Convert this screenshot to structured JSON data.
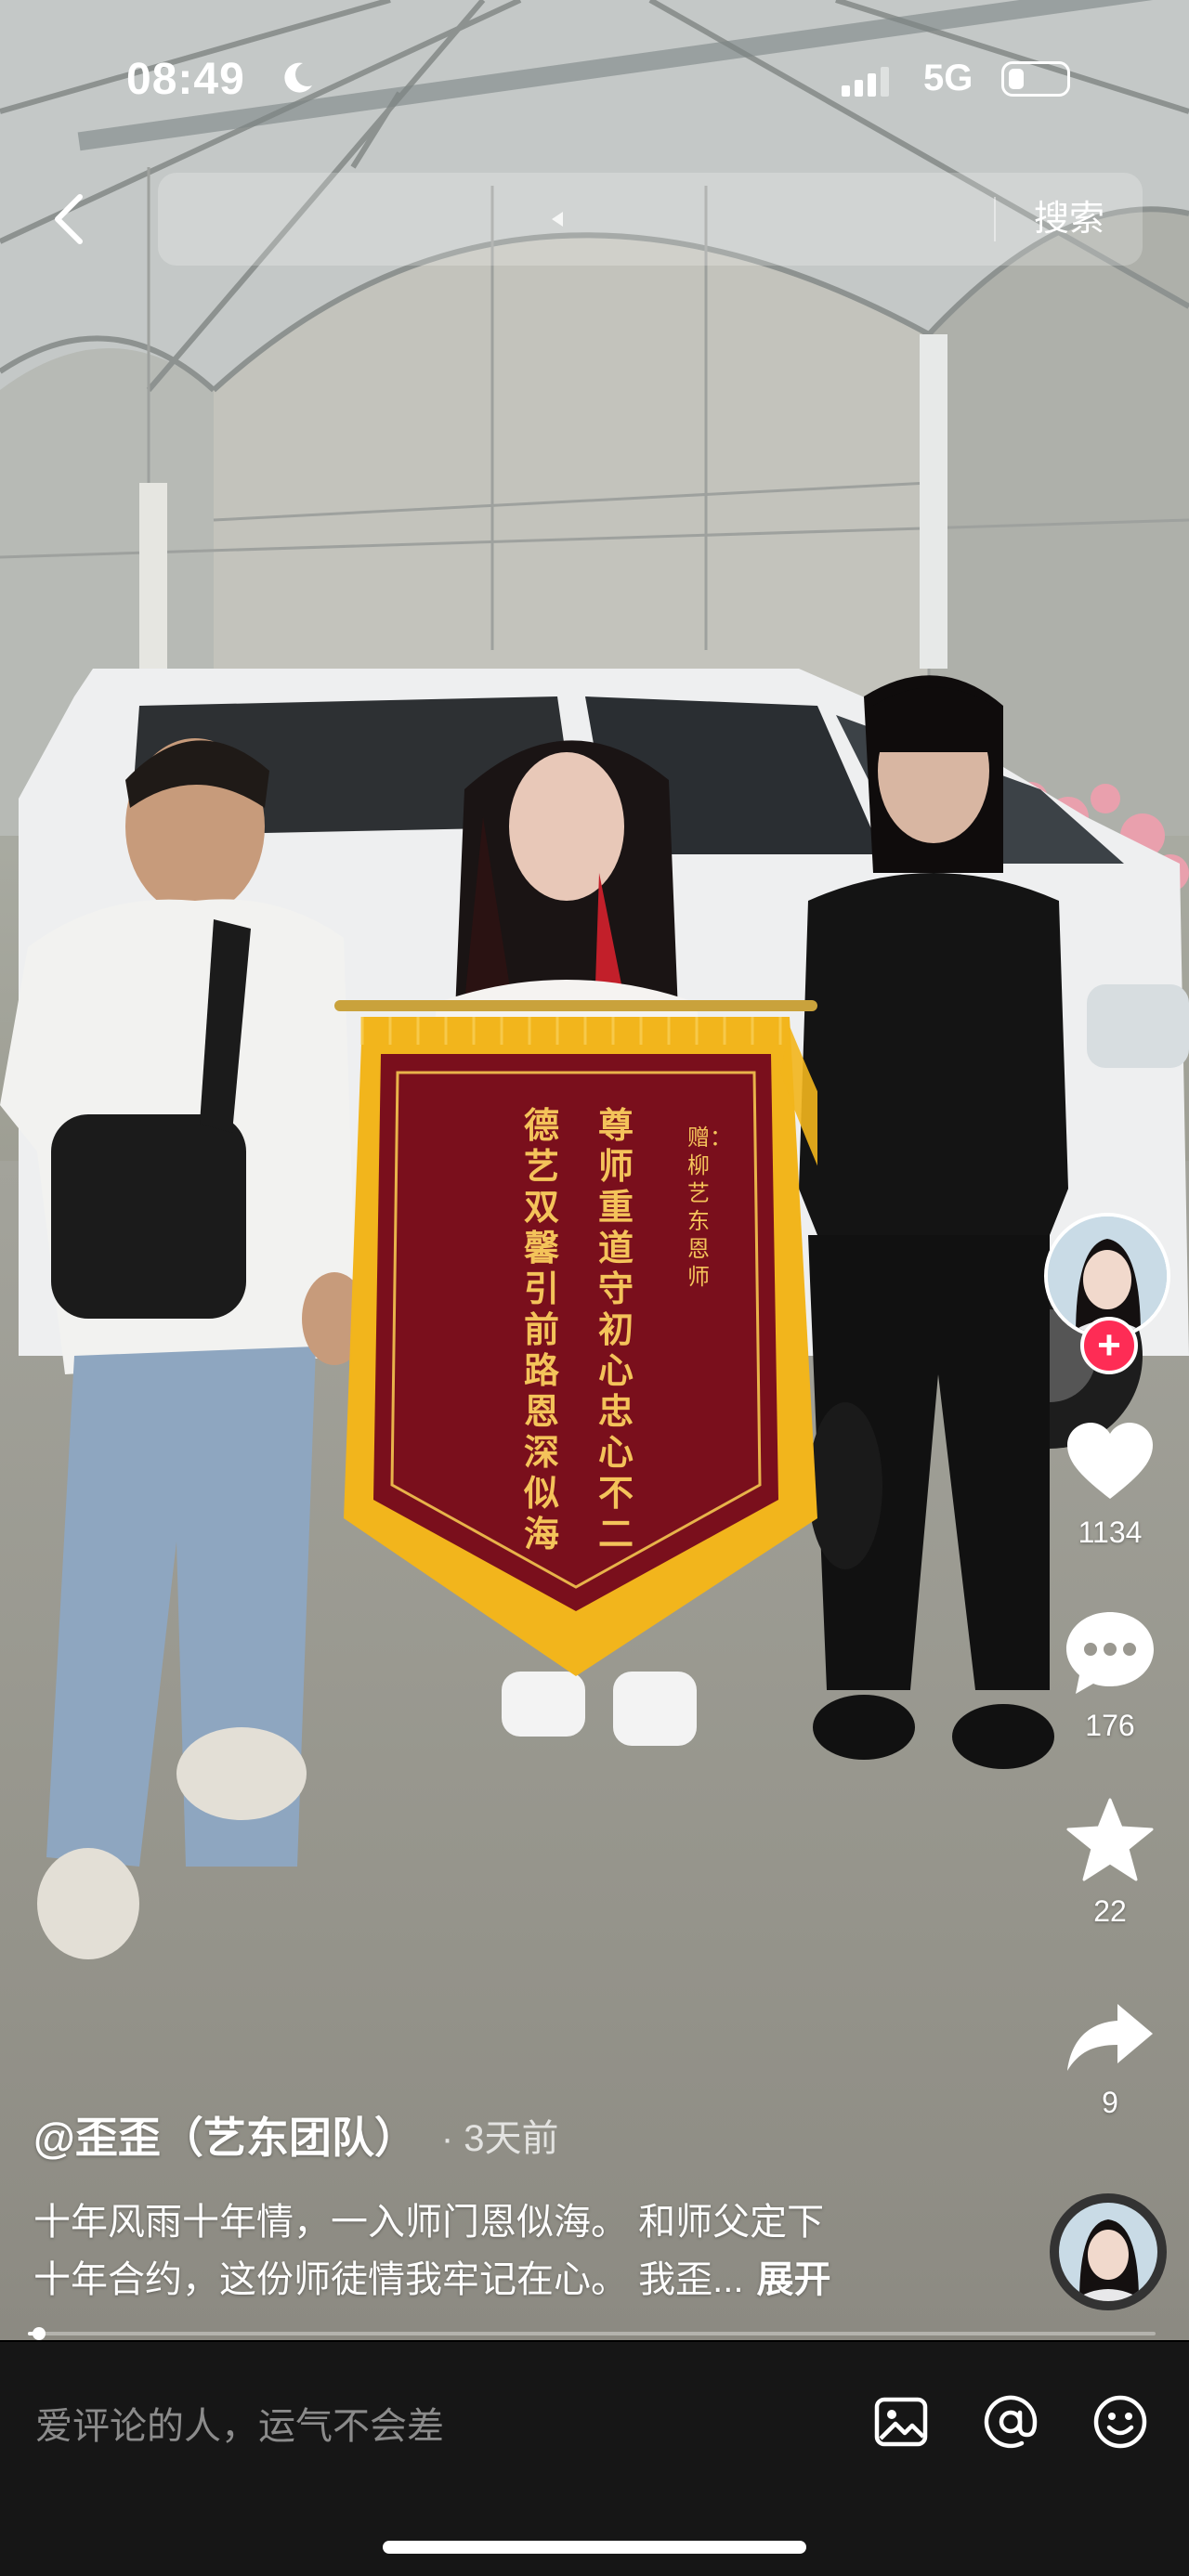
{
  "status_bar": {
    "time": "08:49",
    "network": "5G",
    "icons": [
      "moon-icon",
      "signal-icon",
      "battery-icon"
    ]
  },
  "top_nav": {
    "back_icon": "chevron-left-icon",
    "search_button": "搜索"
  },
  "video": {
    "banner_text": {
      "recipient": "赠：柳艺东恩师",
      "line1": "尊师重道守初心忠心不二",
      "line2": "德艺双馨引前路恩深似海"
    }
  },
  "actions": {
    "likes": "1134",
    "comments": "176",
    "favorites": "22",
    "shares": "9",
    "icons": [
      "heart-icon",
      "comment-icon",
      "star-icon",
      "share-icon"
    ]
  },
  "post": {
    "author": "@歪歪（艺东团队）",
    "time_ago": "· 3天前",
    "caption_line1": "十年风雨十年情，一入师门恩似海。 和师父定下",
    "caption_line2": "十年合约，这份师徒情我牢记在心。 我歪...",
    "expand_label": "展开",
    "progress": 0.01
  },
  "comment_bar": {
    "placeholder": "爱评论的人，运气不会差",
    "icons": [
      "image-icon",
      "at-icon",
      "emoji-icon"
    ]
  },
  "colors": {
    "follow_red": "#fe2c55",
    "banner_red": "#7a0f1c",
    "banner_gold": "#f2b51c"
  }
}
